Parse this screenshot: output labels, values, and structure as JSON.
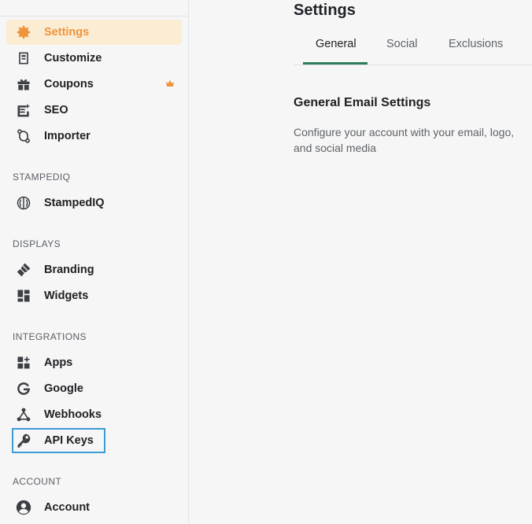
{
  "sidebar": {
    "items": [
      {
        "label": "Settings",
        "icon": "gear-icon"
      },
      {
        "label": "Customize",
        "icon": "customize-icon"
      },
      {
        "label": "Coupons",
        "icon": "gift-icon"
      },
      {
        "label": "SEO",
        "icon": "seo-icon"
      },
      {
        "label": "Importer",
        "icon": "importer-icon"
      }
    ],
    "sections": [
      {
        "title": "STAMPEDIQ",
        "items": [
          {
            "label": "StampedIQ",
            "icon": "brain-icon"
          }
        ]
      },
      {
        "title": "DISPLAYS",
        "items": [
          {
            "label": "Branding",
            "icon": "paint-icon"
          },
          {
            "label": "Widgets",
            "icon": "widgets-icon"
          }
        ]
      },
      {
        "title": "INTEGRATIONS",
        "items": [
          {
            "label": "Apps",
            "icon": "apps-icon"
          },
          {
            "label": "Google",
            "icon": "google-icon"
          },
          {
            "label": "Webhooks",
            "icon": "webhooks-icon"
          },
          {
            "label": "API Keys",
            "icon": "key-icon"
          }
        ]
      },
      {
        "title": "ACCOUNT",
        "items": [
          {
            "label": "Account",
            "icon": "account-icon"
          }
        ]
      }
    ]
  },
  "main": {
    "title": "Settings",
    "tabs": [
      {
        "label": "General"
      },
      {
        "label": "Social"
      },
      {
        "label": "Exclusions"
      }
    ],
    "section_title": "General Email Settings",
    "section_desc": "Configure your account with your email, logo, and social media"
  },
  "colors": {
    "accent": "#f0943b",
    "active_bg": "#fbecd4",
    "tab_underline": "#2e7d5b",
    "focus": "#3d9bd6"
  }
}
